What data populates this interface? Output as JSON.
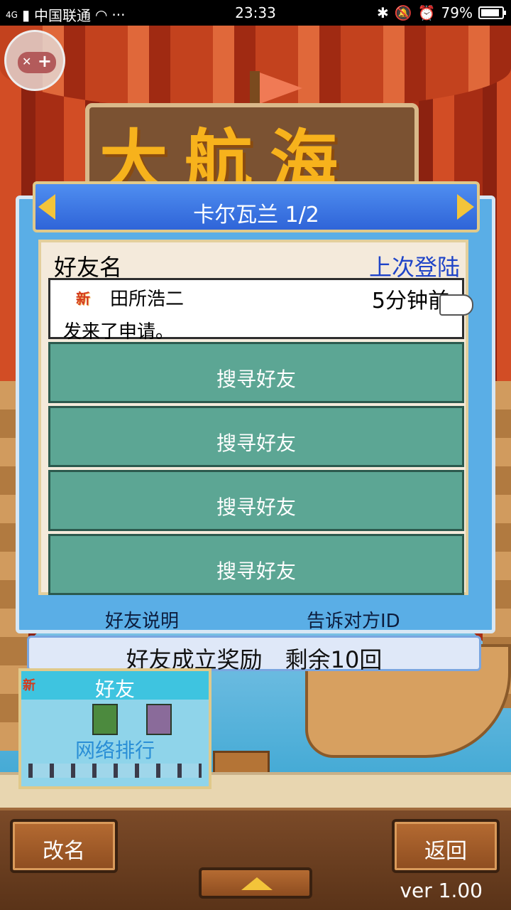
{
  "status_bar": {
    "network": "4G",
    "carrier": "中国联通",
    "more": "···",
    "time": "23:33",
    "battery": "79%"
  },
  "title_sign": "大航海",
  "dialog": {
    "title": "卡尔瓦兰 1/2",
    "header_name": "好友名",
    "header_last_login": "上次登陆",
    "request": {
      "badge": "新",
      "name": "田所浩二",
      "time": "5分钟前",
      "message": "发来了申请。"
    },
    "search_rows": [
      "搜寻好友",
      "搜寻好友",
      "搜寻好友",
      "搜寻好友"
    ],
    "footer_left": "好友说明",
    "footer_right": "告诉对方ID"
  },
  "reward_bar": "好友成立奖励　剩余10回",
  "friends_card": {
    "badge": "新",
    "title": "好友",
    "ranking": "网络排行"
  },
  "bottom": {
    "rename": "改名",
    "back": "返回",
    "version": "ver 1.00"
  }
}
